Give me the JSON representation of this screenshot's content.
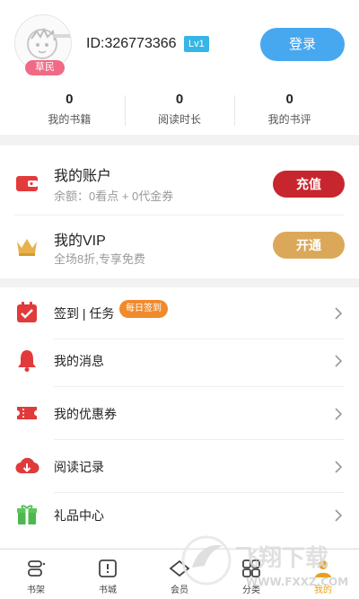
{
  "profile": {
    "rank_badge": "草民",
    "user_id": "ID:326773366",
    "level": "Lv1",
    "login_label": "登录"
  },
  "stats": [
    {
      "value": "0",
      "label": "我的书籍"
    },
    {
      "value": "0",
      "label": "阅读时长"
    },
    {
      "value": "0",
      "label": "我的书评"
    }
  ],
  "account": {
    "wallet": {
      "title": "我的账户",
      "subtitle": "余额：0看点 + 0代金券",
      "button": "充值",
      "icon": "wallet-icon"
    },
    "vip": {
      "title": "我的VIP",
      "subtitle": "全场8折,专享免费",
      "button": "开通",
      "icon": "crown-icon"
    }
  },
  "menu": [
    {
      "label": "签到 | 任务",
      "tag": "每日签到",
      "icon": "calendar-check-icon"
    },
    {
      "label": "我的消息",
      "icon": "bell-icon"
    },
    {
      "label": "我的优惠券",
      "icon": "coupon-icon"
    },
    {
      "label": "阅读记录",
      "icon": "cloud-download-icon"
    },
    {
      "label": "礼品中心",
      "icon": "gift-icon"
    }
  ],
  "tabs": [
    {
      "label": "书架",
      "icon": "bookshelf-icon"
    },
    {
      "label": "书城",
      "icon": "bookstore-icon"
    },
    {
      "label": "会员",
      "icon": "vip-icon"
    },
    {
      "label": "分类",
      "icon": "category-icon"
    },
    {
      "label": "我的",
      "icon": "profile-icon",
      "active": true
    }
  ],
  "watermark": {
    "text": "飞翔下载",
    "url": "WWW.FXXZ.COM"
  },
  "colors": {
    "login": "#47a8ef",
    "recharge": "#c8262f",
    "vip_open": "#dba85a",
    "accent_red": "#e03a3a",
    "active_tab": "#e6a120"
  }
}
